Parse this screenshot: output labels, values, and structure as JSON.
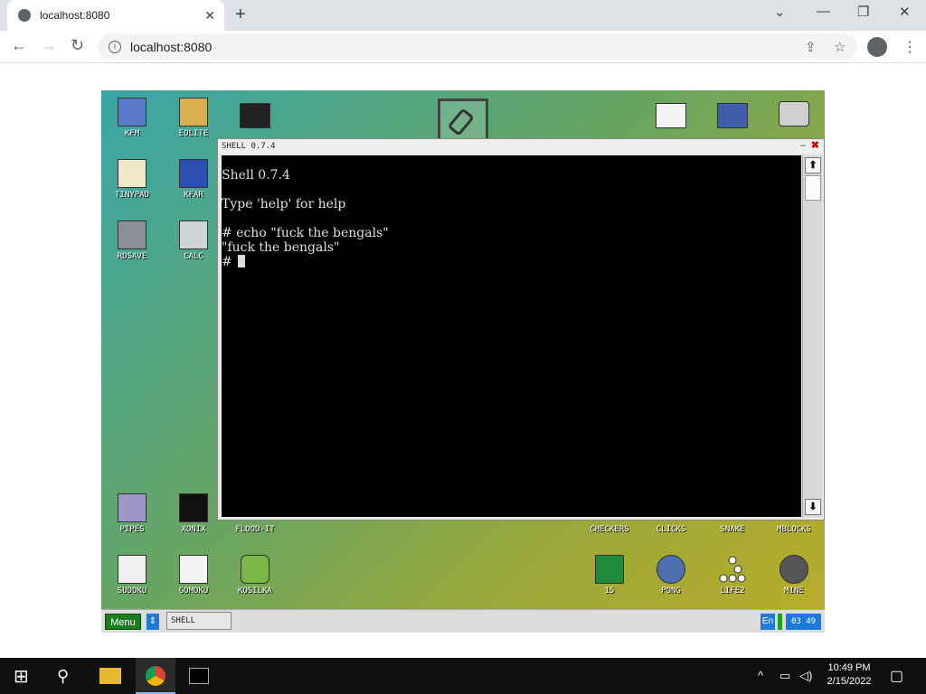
{
  "browser": {
    "tab_title": "localhost:8080",
    "tab_close": "✕",
    "new_tab": "+",
    "url": "localhost:8080",
    "min": "⌄",
    "minimize": "—",
    "restore": "❐",
    "close": "✕",
    "back": "←",
    "forward": "→",
    "reload": "↻",
    "share": "⇪",
    "star": "☆",
    "menu": "⋮"
  },
  "desktop": {
    "icons_left": [
      {
        "label": "KFM",
        "color": "#5b79c9"
      },
      {
        "label": "EOLITE",
        "color": "#d9b050"
      },
      {
        "label": "TINYPAD",
        "color": "#efe7c8"
      },
      {
        "label": "KFAR",
        "color": "#2f4fb5"
      },
      {
        "label": "RDSAVE",
        "color": "#8a8f96"
      },
      {
        "label": "CALC",
        "color": "#d0d4d9"
      }
    ],
    "icons_bottom": [
      {
        "label": "PIPES",
        "color": "#9f96c8"
      },
      {
        "label": "XONIX",
        "color": "#111111"
      },
      {
        "label": "FLOOD-IT",
        "color": "#5aa85a"
      },
      {
        "label": "CHECKERS",
        "color": "#a06030"
      },
      {
        "label": "CLICKS",
        "color": "#c04040"
      },
      {
        "label": "SNAKE",
        "color": "#507050"
      },
      {
        "label": "MBLOCKS",
        "color": "#606060"
      },
      {
        "label": "SUDOKU",
        "color": "#f0f0f0"
      },
      {
        "label": "GOMOKU",
        "color": "#f4f4f4"
      },
      {
        "label": "KOSILKA",
        "color": "#7ab648"
      },
      {
        "label": "15",
        "color": "#1f8a3a"
      },
      {
        "label": "PONG",
        "color": "#4e6fb0"
      },
      {
        "label": "LIFE2",
        "color": "#ffffff"
      },
      {
        "label": "MINE",
        "color": "#555555"
      }
    ]
  },
  "shell": {
    "title": "SHELL 0.7.4",
    "minimize": "–",
    "close": "✖",
    "lines": [
      "Shell 0.7.4",
      "",
      "Type 'help' for help",
      "",
      "# echo \"fuck the bengals\"",
      "\"fuck the bengals\""
    ],
    "prompt": "#",
    "scroll_up": "⬆",
    "scroll_down": "⬇"
  },
  "kolibri_taskbar": {
    "menu": "Menu",
    "switch": "⇕",
    "task": "SHELL",
    "lang": "En",
    "clock": "03 49"
  },
  "windows_taskbar": {
    "time": "10:49 PM",
    "date": "2/15/2022"
  }
}
